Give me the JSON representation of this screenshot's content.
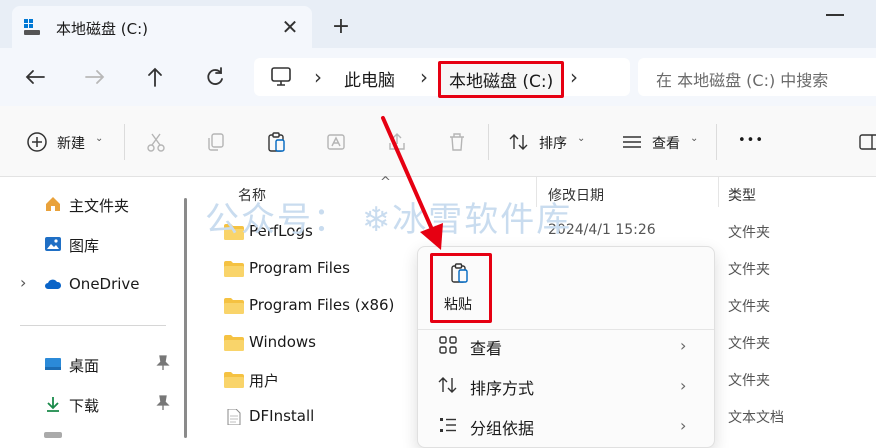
{
  "tab": {
    "title": "本地磁盘 (C:)",
    "close_glyph": "✕",
    "new_glyph": "+"
  },
  "address": {
    "crumbs": [
      "此电脑",
      "本地磁盘 (C:)"
    ],
    "separator": "›",
    "search_placeholder": "在 本地磁盘 (C:) 中搜索"
  },
  "toolbar": {
    "new_label": "新建",
    "sort_label": "排序",
    "view_label": "查看",
    "more_glyph": "•••",
    "chevron_glyph": "⌄"
  },
  "sidebar": {
    "items": [
      {
        "label": "主文件夹",
        "icon": "home-icon"
      },
      {
        "label": "图库",
        "icon": "gallery-icon"
      },
      {
        "label": "OneDrive",
        "icon": "onedrive-icon"
      },
      {
        "label": "桌面",
        "icon": "desktop-icon"
      },
      {
        "label": "下载",
        "icon": "download-icon"
      }
    ],
    "expand_glyph": "›"
  },
  "filelist": {
    "columns": {
      "name": "名称",
      "modified": "修改日期",
      "type": "类型"
    },
    "sort_glyph": "^",
    "rows": [
      {
        "name": "PerfLogs",
        "modified": "2024/4/1 15:26",
        "type": "文件夹",
        "icon": "folder-icon"
      },
      {
        "name": "Program Files",
        "modified": "",
        "type": "文件夹",
        "icon": "folder-icon"
      },
      {
        "name": "Program Files (x86)",
        "modified": "",
        "type": "文件夹",
        "icon": "folder-icon"
      },
      {
        "name": "Windows",
        "modified": "",
        "type": "文件夹",
        "icon": "folder-icon"
      },
      {
        "name": "用户",
        "modified": "",
        "type": "文件夹",
        "icon": "folder-icon"
      },
      {
        "name": "DFInstall",
        "modified": "",
        "type": "文本文档",
        "icon": "text-file-icon"
      }
    ]
  },
  "watermark": "公众号： ❄冰雪软件库",
  "context_menu": {
    "paste_label": "粘贴",
    "items": [
      {
        "label": "查看",
        "icon": "grid-icon"
      },
      {
        "label": "排序方式",
        "icon": "sort-icon"
      },
      {
        "label": "分组依据",
        "icon": "group-icon"
      }
    ],
    "chevron_glyph": "›"
  },
  "colors": {
    "highlight": "#e60012",
    "folder": "#f5c242",
    "accent": "#0067c0"
  }
}
